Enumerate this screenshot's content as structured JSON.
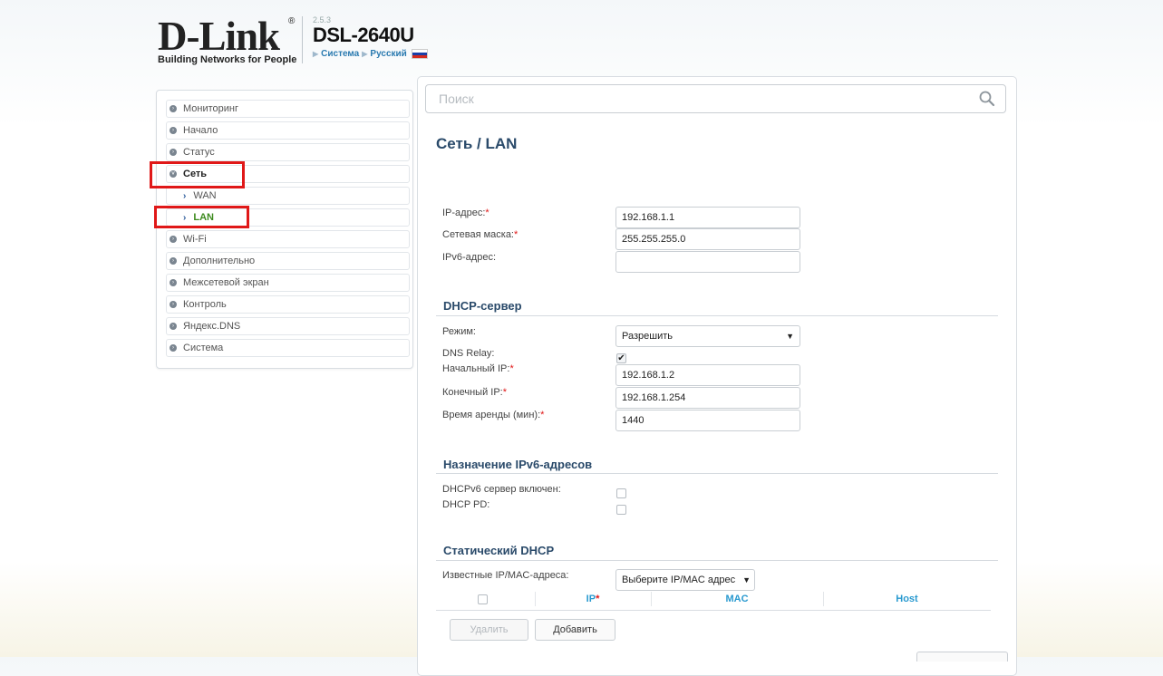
{
  "header": {
    "brand": "D-Link",
    "tagline": "Building Networks for People",
    "version": "2.5.3",
    "model": "DSL-2640U",
    "breadcrumb": [
      "Система",
      "Русский"
    ]
  },
  "sidebar": {
    "items": [
      {
        "label": "Мониторинг"
      },
      {
        "label": "Начало"
      },
      {
        "label": "Статус"
      },
      {
        "label": "Сеть"
      },
      {
        "label": "WAN"
      },
      {
        "label": "LAN"
      },
      {
        "label": "Wi-Fi"
      },
      {
        "label": "Дополнительно"
      },
      {
        "label": "Межсетевой экран"
      },
      {
        "label": "Контроль"
      },
      {
        "label": "Яндекс.DNS"
      },
      {
        "label": "Система"
      }
    ]
  },
  "search": {
    "placeholder": "Поиск"
  },
  "page": {
    "title": "Сеть /  LAN"
  },
  "lan": {
    "ip_label": "IP-адрес:",
    "ip_value": "192.168.1.1",
    "mask_label": "Сетевая маска:",
    "mask_value": "255.255.255.0",
    "ipv6_label": "IPv6-адрес:",
    "ipv6_value": ""
  },
  "dhcp": {
    "title": "DHCP-сервер",
    "mode_label": "Режим:",
    "mode_value": "Разрешить",
    "relay_label": "DNS Relay:",
    "relay_checked": "✔",
    "start_label": "Начальный IP:",
    "start_value": "192.168.1.2",
    "end_label": "Конечный IP:",
    "end_value": "192.168.1.254",
    "lease_label": "Время аренды (мин):",
    "lease_value": "1440"
  },
  "ipv6": {
    "title": "Назначение IPv6-адресов",
    "dhcpv6_label": "DHCPv6 сервер включен:",
    "pd_label": "DHCP PD:"
  },
  "static_dhcp": {
    "title": "Статический DHCP",
    "known_label": "Известные IP/MAC-адреса:",
    "known_select": "Выберите IP/MAC адрес",
    "columns": [
      "IP",
      "MAC",
      "Host"
    ],
    "delete_label": "Удалить",
    "add_label": "Добавить"
  },
  "colors": {
    "accent": "#2a4a6a",
    "highlight": "#e01818",
    "active_nav": "#3c8a1e",
    "column_header": "#2a9ad0"
  }
}
